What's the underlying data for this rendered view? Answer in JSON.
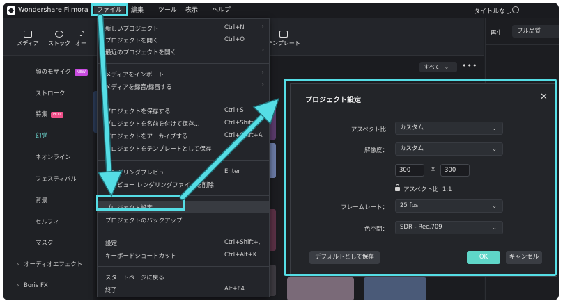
{
  "app": {
    "name": "Wondershare Filmora",
    "project_name": "タイトルなし"
  },
  "menubar": {
    "file": "ファイル",
    "edit": "編集",
    "tools": "ツール",
    "view": "表示",
    "help": "ヘルプ"
  },
  "toolbar": {
    "media": "メディア",
    "stock": "ストック",
    "audio": "オー",
    "templates": "テンプレート"
  },
  "player": {
    "play": "再生",
    "quality": "フル品質"
  },
  "sidebar": {
    "items": [
      {
        "label": "顔のモザイク",
        "badge": "NEW"
      },
      {
        "label": "ストローク"
      },
      {
        "label": "特集",
        "badge": "HOT"
      },
      {
        "label": "幻覚"
      },
      {
        "label": "ネオンライン"
      },
      {
        "label": "フェスティバル"
      },
      {
        "label": "背景"
      },
      {
        "label": "セルフィ"
      },
      {
        "label": "マスク"
      }
    ],
    "groups": [
      "オーディオエフェクト",
      "Boris FX"
    ]
  },
  "content": {
    "filter": "すべて",
    "more": "•••"
  },
  "file_menu": {
    "items": [
      {
        "label": "新しいプロジェクト",
        "shortcut": "Ctrl+N",
        "submenu": true
      },
      {
        "label": "プロジェクトを開く",
        "shortcut": "Ctrl+O"
      },
      {
        "label": "最近のプロジェクトを開く",
        "submenu": true
      },
      {
        "label": "メディアをインポート",
        "submenu": true
      },
      {
        "label": "メディアを録音/録画する",
        "submenu": true
      },
      {
        "label": "プロジェクトを保存する",
        "shortcut": "Ctrl+S"
      },
      {
        "label": "プロジェクトを名前を付けて保存...",
        "shortcut": "Ctrl+Shift+"
      },
      {
        "label": "プロジェクトをアーカイブする",
        "shortcut": "Ctrl+Shift+A"
      },
      {
        "label": "プロジェクトをテンプレートとして保存"
      },
      {
        "label": "レンダリングプレビュー",
        "shortcut": "Enter"
      },
      {
        "label": "プレビュー レンダリングファイルを削除"
      },
      {
        "label": "プロジェクト設定"
      },
      {
        "label": "プロジェクトのバックアップ"
      },
      {
        "label": "設定",
        "shortcut": "Ctrl+Shift+,"
      },
      {
        "label": "キーボードショートカット",
        "shortcut": "Ctrl+Alt+K"
      },
      {
        "label": "スタートページに戻る"
      },
      {
        "label": "終了",
        "shortcut": "Alt+F4"
      }
    ],
    "submenu_arrow": "›"
  },
  "dialog": {
    "title": "プロジェクト設定",
    "close": "✕",
    "aspect_label": "アスペクト比:",
    "aspect_value": "カスタム",
    "resolution_label": "解像度：",
    "resolution_value": "カスタム",
    "width": "300",
    "x": "x",
    "height": "300",
    "aspect_lock": "アスペクト比",
    "aspect_ratio": "1:1",
    "framerate_label": "フレームレート：",
    "framerate_value": "25 fps",
    "colorspace_label": "色空間：",
    "colorspace_value": "SDR - Rec.709",
    "save_default": "デフォルトとして保存",
    "ok": "OK",
    "cancel": "キャンセル",
    "chevron": "⌄"
  },
  "colors": {
    "accent": "#5fd6c8",
    "annotation": "#55dde5"
  }
}
